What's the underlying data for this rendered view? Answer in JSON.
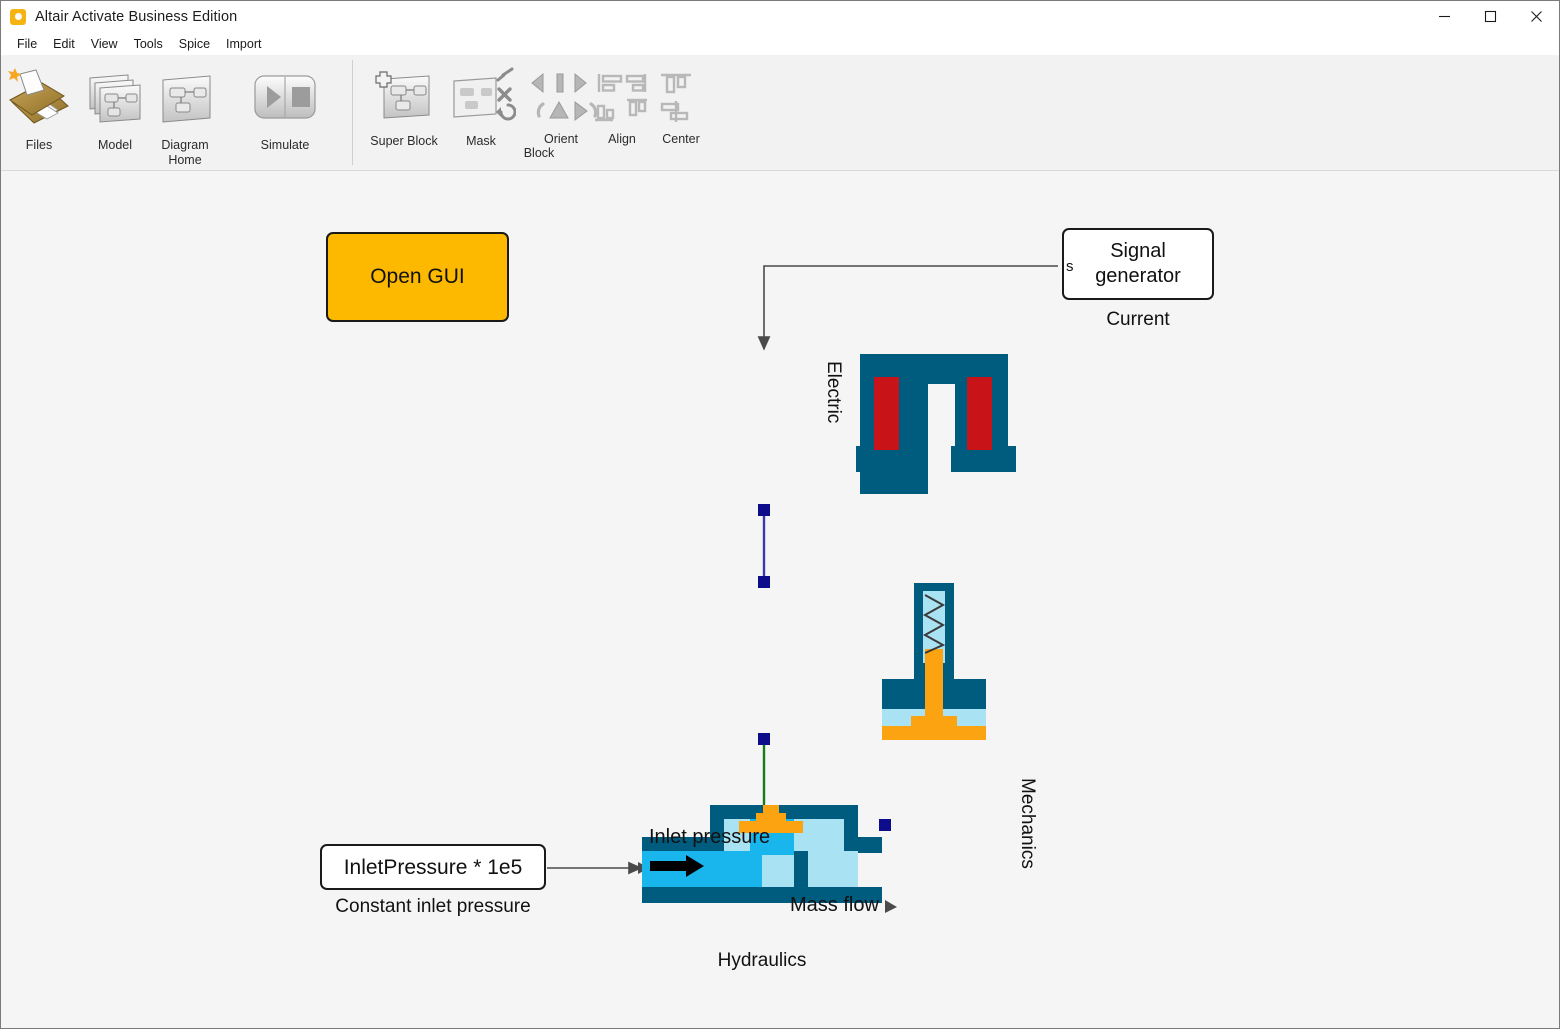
{
  "window": {
    "title": "Altair Activate Business Edition",
    "icon": "app-logo-icon",
    "controls": {
      "minimize": "—",
      "maximize": "□",
      "close": "✕"
    }
  },
  "menubar": {
    "items": [
      {
        "label": "File"
      },
      {
        "label": "Edit"
      },
      {
        "label": "View"
      },
      {
        "label": "Tools"
      },
      {
        "label": "Spice"
      },
      {
        "label": "Import"
      }
    ]
  },
  "ribbon": {
    "groups": [
      {
        "name": "main",
        "items": [
          {
            "label": "Files",
            "icon": "files-icon"
          },
          {
            "label": "Model",
            "icon": "model-icon"
          },
          {
            "label": "Diagram\nHome",
            "label_line1": "Diagram",
            "label_line2": "Home",
            "icon": "diagram-home-icon"
          },
          {
            "label": "Simulate",
            "icon": "simulate-icon"
          }
        ]
      },
      {
        "name": "block",
        "group_label": "Block",
        "items": [
          {
            "label": "Super Block",
            "icon": "super-block-icon"
          },
          {
            "label": "Mask",
            "icon": "mask-icon"
          },
          {
            "label": "Orient",
            "icon": "orient-icon"
          },
          {
            "label": "Align",
            "icon": "align-icon"
          },
          {
            "label": "Center",
            "icon": "center-icon"
          }
        ]
      }
    ]
  },
  "diagram": {
    "blocks": {
      "open_gui": {
        "text": "Open GUI",
        "color": "#fcb900"
      },
      "signal_generator": {
        "line1": "Signal",
        "line2": "generator",
        "port_label": "s",
        "caption": "Current"
      },
      "electric": {
        "caption": "Electric",
        "body_color": "#005c7f",
        "coil_color": "#c81419"
      },
      "mechanics": {
        "caption": "Mechanics",
        "body_color": "#005c7f",
        "piston_color": "#fca311",
        "fluid_color": "#a9e2f3"
      },
      "hydraulics": {
        "caption": "Hydraulics",
        "inlet_label": "Inlet pressure",
        "outlet_label": "Mass flow",
        "body_color": "#005c7f",
        "fluid_color": "#19b5ed",
        "fluid_light_color": "#a9e2f3",
        "valve_color": "#fca311"
      },
      "constant_inlet_pressure": {
        "text": "InletPressure * 1e5",
        "caption": "Constant inlet pressure"
      }
    },
    "links": {
      "signal_to_electric_color": "#4a4a4a",
      "electric_to_mechanics_color": "#121278",
      "mechanics_to_hydraulics_color": "#1a7a1a",
      "constant_to_hydraulics_color": "#4a4a4a",
      "port_square_color": "#0d0d8c"
    }
  }
}
